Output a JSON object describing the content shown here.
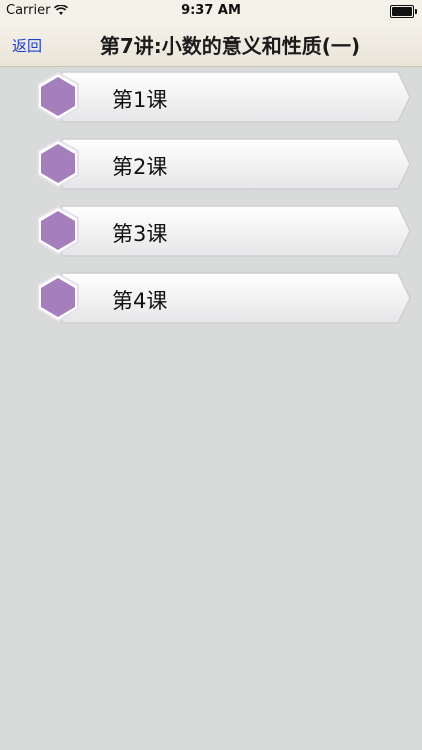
{
  "status_bar": {
    "carrier": "Carrier",
    "time": "9:37 AM"
  },
  "nav": {
    "back_label": "返回",
    "title": "第7讲:小数的意义和性质(一)"
  },
  "lessons": [
    {
      "label": "第1课"
    },
    {
      "label": "第2课"
    },
    {
      "label": "第3课"
    },
    {
      "label": "第4课"
    }
  ],
  "colors": {
    "background": "#d9dbda",
    "hexagon": "#a57fbc",
    "back_link": "#1f3fd0"
  }
}
